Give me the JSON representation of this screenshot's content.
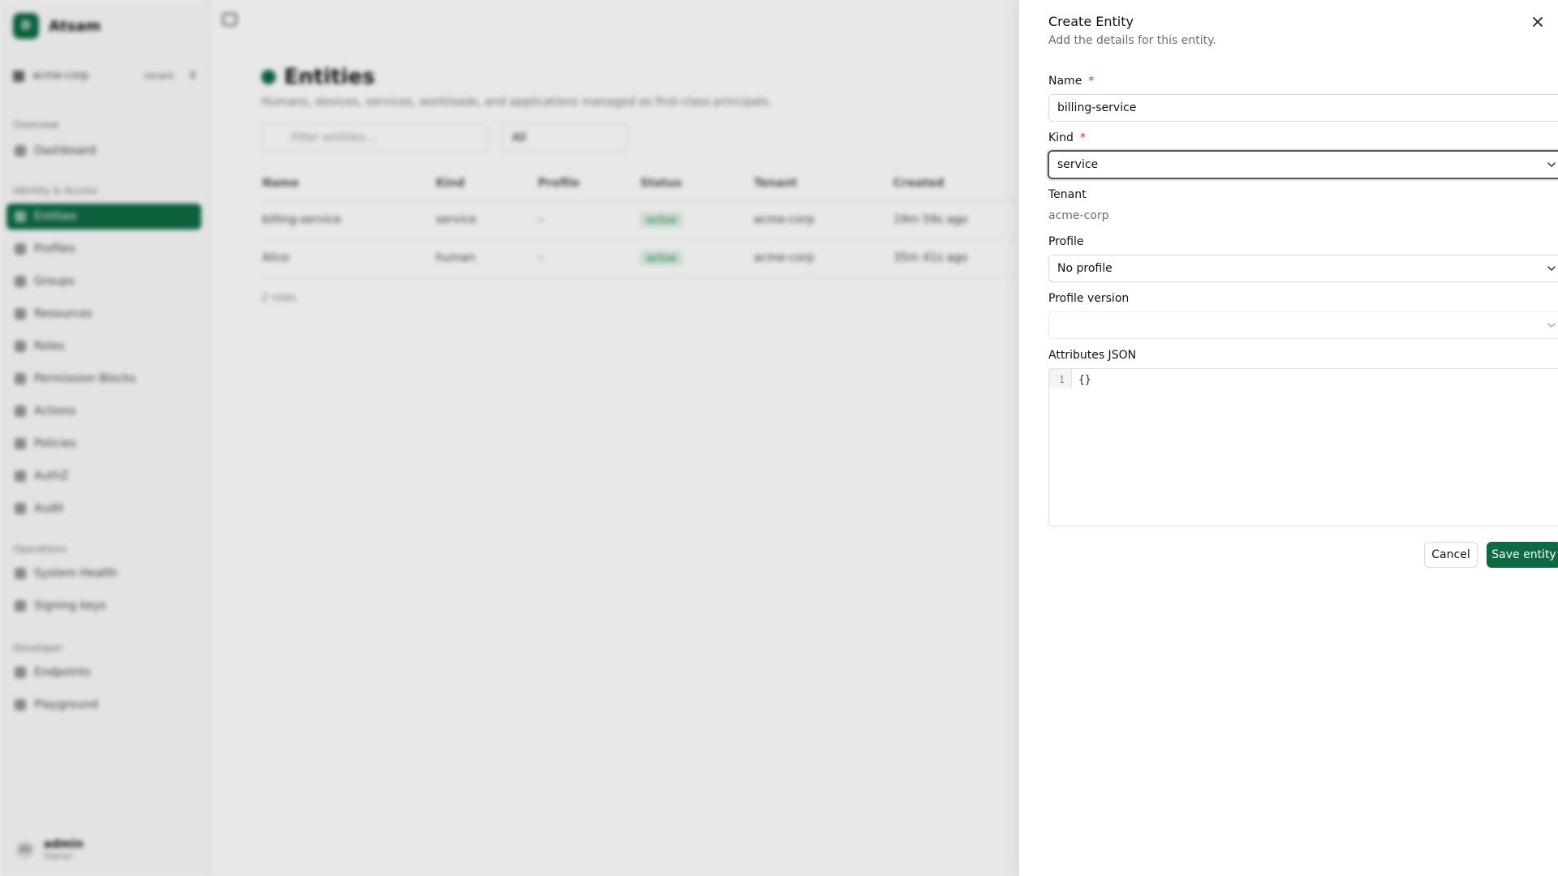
{
  "app": {
    "brand_initial": "D",
    "brand_name": "Atsam",
    "tenant": "acme-corp",
    "tenant_badge": "tenant",
    "sections": [
      "Overview",
      "Identity & Access",
      "Operations",
      "Developer"
    ],
    "nav": {
      "dashboard": "Dashboard",
      "entities": "Entities",
      "profiles": "Profiles",
      "groups": "Groups",
      "resources": "Resources",
      "roles": "Roles",
      "permission_blocks": "Permission Blocks",
      "actions": "Actions",
      "policies": "Policies",
      "authz": "AuthZ",
      "audit": "Audit",
      "system_health": "System Health",
      "signing_keys": "Signing keys",
      "endpoints": "Endpoints",
      "playground": "Playground"
    },
    "user": {
      "initials": "AD",
      "name": "admin",
      "role": "Owner"
    }
  },
  "page": {
    "title": "Entities",
    "subtitle": "Humans, devices, services, workloads, and applications managed as first-class principals.",
    "filter_placeholder": "Filter entities...",
    "kind_filter": "All",
    "table": {
      "columns": [
        "Name",
        "Kind",
        "Profile",
        "Status",
        "Tenant",
        "Created"
      ],
      "rows": [
        [
          "billing-service",
          "service",
          "–",
          "active",
          "acme-corp",
          "19m 59s ago"
        ],
        [
          "Alice",
          "human",
          "–",
          "active",
          "acme-corp",
          "35m 41s ago"
        ]
      ]
    },
    "row_count": "2 rows"
  },
  "drawer": {
    "title": "Create Entity",
    "description": "Add the details for this entity.",
    "name_label": "Name",
    "name_value": "billing-service",
    "kind_label": "Kind",
    "kind_value": "service",
    "tenant_label": "Tenant",
    "tenant_value": "acme-corp",
    "profile_label": "Profile",
    "profile_value": "No profile",
    "profile_version_label": "Profile version",
    "profile_version_value": "",
    "attributes_label": "Attributes JSON",
    "editor_line": "1",
    "editor_code": "{}",
    "required_marker": "*",
    "cancel_label": "Cancel",
    "save_label": "Save entity"
  },
  "colors": {
    "accent": "#0d6b43",
    "required": "#d93025"
  }
}
